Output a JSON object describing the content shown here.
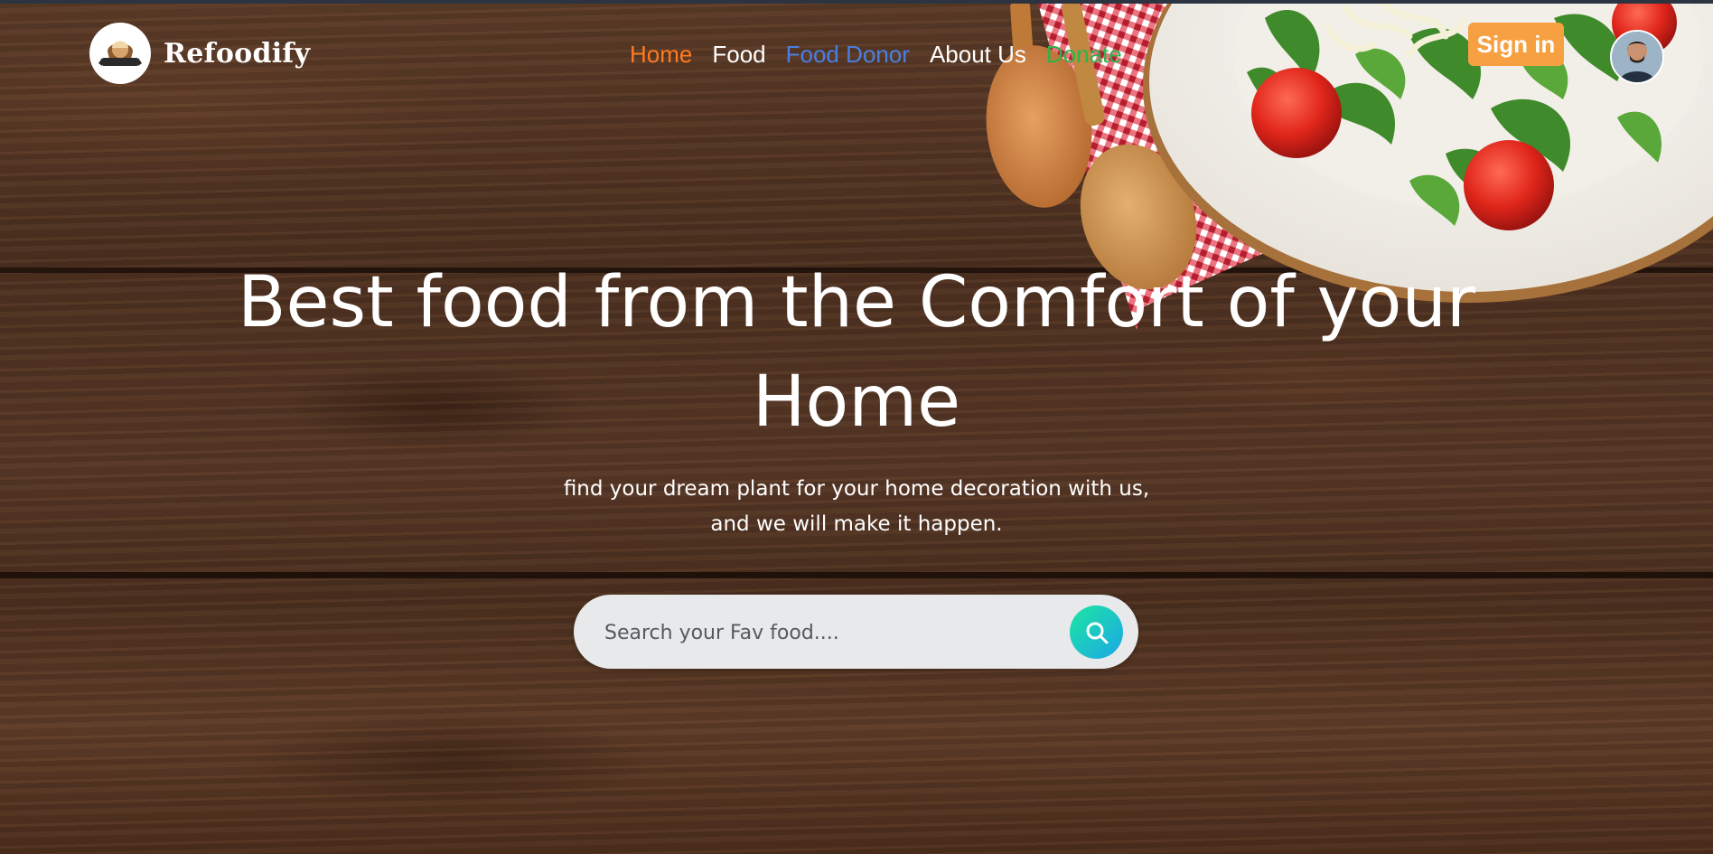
{
  "brand": {
    "name": "Refoodify",
    "logo_badge_text": "REFOODIFY"
  },
  "nav": {
    "items": [
      {
        "label": "Home",
        "color": "#ff7a21"
      },
      {
        "label": "Food",
        "color": "#ffffff"
      },
      {
        "label": "Food Donor",
        "color": "#4a7fe0"
      },
      {
        "label": "About Us",
        "color": "#ffffff"
      },
      {
        "label": "Donate",
        "color": "#2fb24a"
      }
    ]
  },
  "auth": {
    "signin_label": "Sign in",
    "signin_color": "#f7a041"
  },
  "hero": {
    "title_line1": "Best food from the Comfort of your",
    "title_line2": "Home",
    "subtitle_line1": "find your dream plant for your home decoration with us,",
    "subtitle_line2": "and we will make it happen."
  },
  "search": {
    "placeholder": "Search your Fav food....",
    "icon": "search-icon"
  }
}
